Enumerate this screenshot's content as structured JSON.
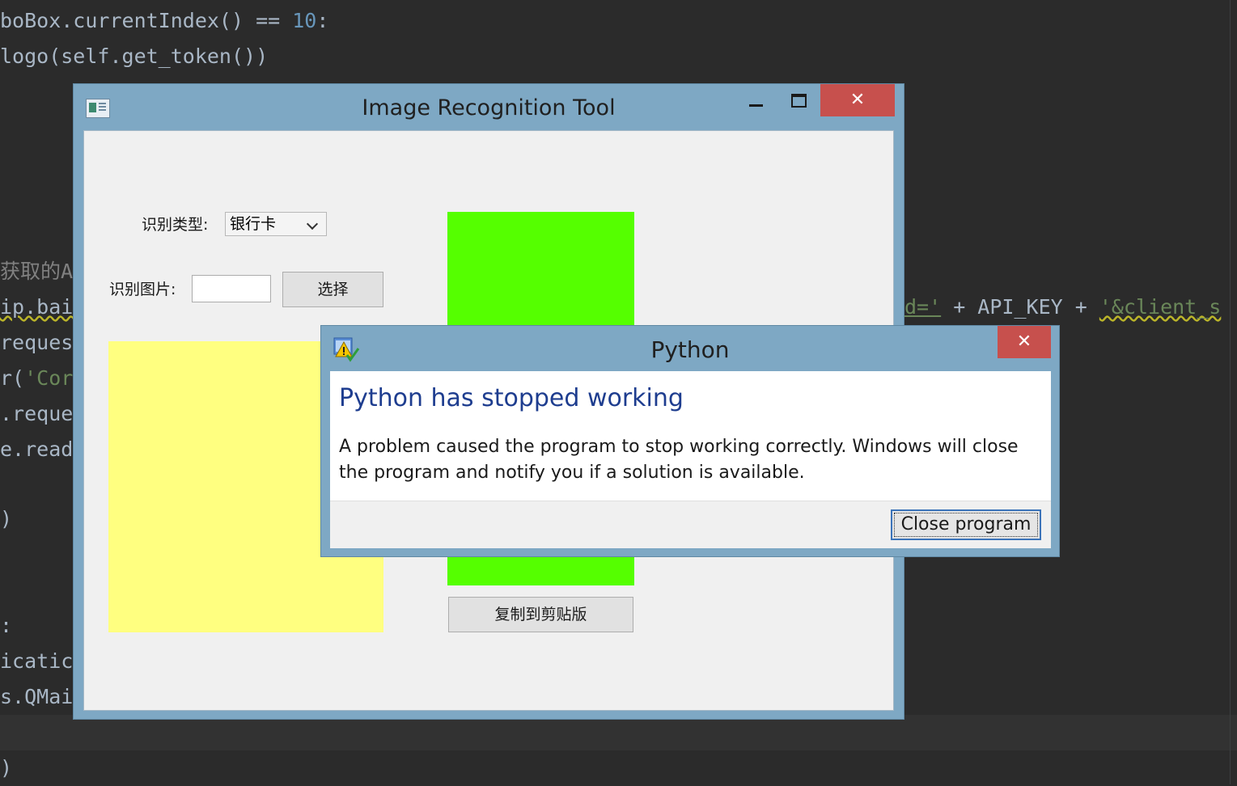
{
  "editor": {
    "lines": [
      {
        "pre": "boBox.currentIndex() == ",
        "num": "10",
        "post": ":"
      },
      {
        "text": "logo(self.get_token())"
      },
      {
        "comment": "获取的A"
      },
      {
        "text": "ip.bai"
      },
      {
        "text": "reques"
      },
      {
        "pre": "r(",
        "str": "'Cor"
      },
      {
        "text": ".reque"
      },
      {
        "text": "e.read"
      },
      {
        "text": ")"
      },
      {
        "text": ":"
      },
      {
        "text": "icatic"
      },
      {
        "text": "s.QMai"
      },
      {
        "text": ")"
      }
    ],
    "fragment": {
      "str1": "d='",
      "mid": " + API_KEY + ",
      "str2": "'&client_s"
    }
  },
  "main_window": {
    "title": "Image Recognition Tool",
    "close_glyph": "✕",
    "type_label": "识别类型:",
    "type_value": "银行卡",
    "image_label": "识别图片:",
    "select_button": "选择",
    "copy_button": "复制到剪贴版",
    "colors": {
      "preview": "#ffff80",
      "result": "#55ff00"
    }
  },
  "dialog": {
    "title": "Python",
    "close_glyph": "✕",
    "heading": "Python has stopped working",
    "message": "A problem caused the program to stop working correctly. Windows will close the program and notify you if a solution is available.",
    "close_button": "Close program"
  }
}
